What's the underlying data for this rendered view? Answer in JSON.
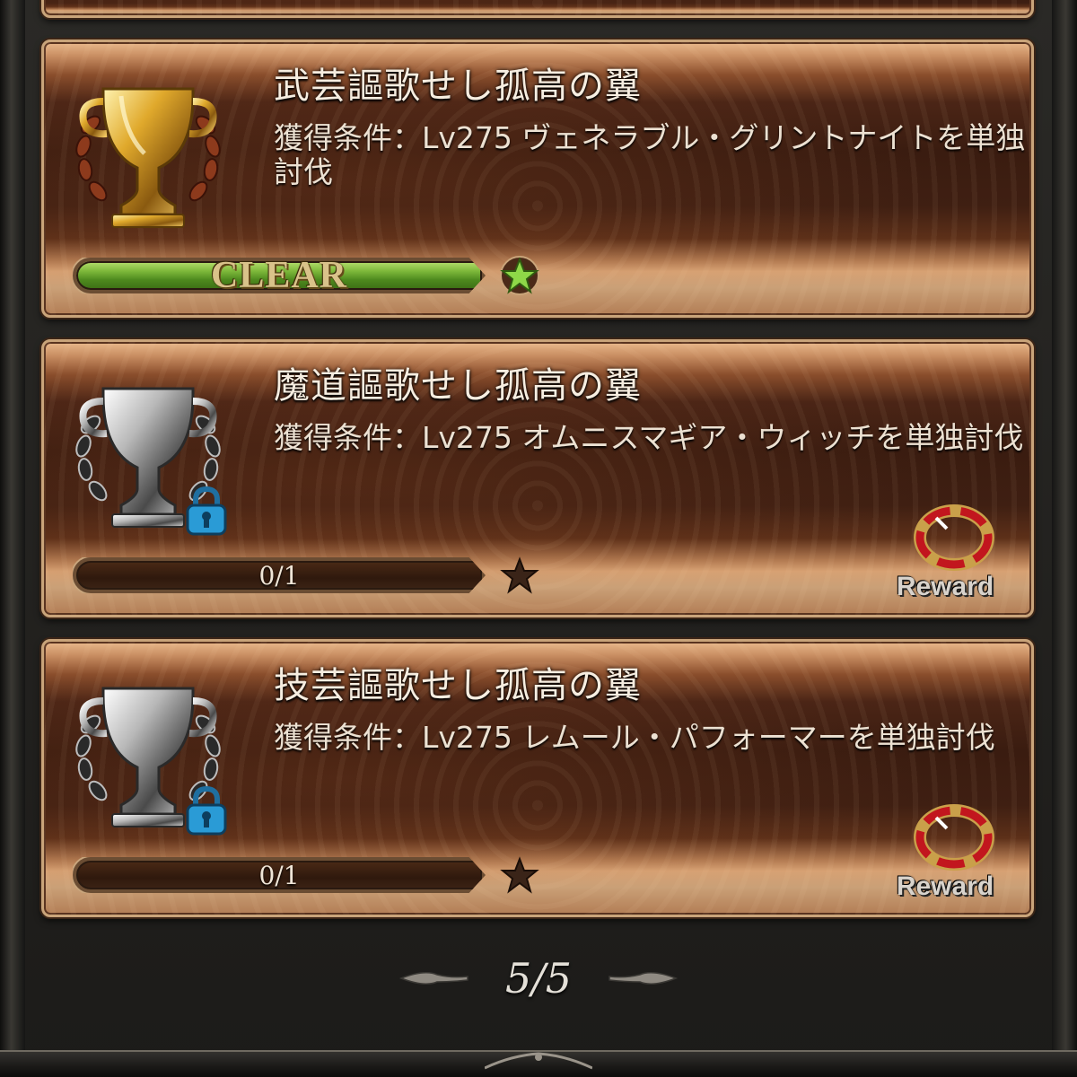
{
  "achievements": [
    {
      "title": "武芸謳歌せし孤高の翼",
      "condition": "獲得条件：Lv275 ヴェネラブル・グリントナイトを単独討伐",
      "status": "CLEAR",
      "trophy": "gold-trophy-icon",
      "star": "green-star-icon",
      "locked": false,
      "progress": 1.0
    },
    {
      "title": "魔道謳歌せし孤高の翼",
      "condition": "獲得条件：Lv275 オムニスマギア・ウィッチを単独討伐",
      "progress_text": "0/1",
      "trophy": "silver-trophy-icon",
      "star": "dark-star-icon",
      "locked": true,
      "reward_label": "Reward",
      "progress": 0.0
    },
    {
      "title": "技芸謳歌せし孤高の翼",
      "condition": "獲得条件：Lv275 レムール・パフォーマーを単独討伐",
      "progress_text": "0/1",
      "trophy": "silver-trophy-icon",
      "star": "dark-star-icon",
      "locked": true,
      "reward_label": "Reward",
      "progress": 0.0
    }
  ],
  "pager": {
    "text": "5/5",
    "current": 5,
    "total": 5
  },
  "colors": {
    "card_border": "#c9a47a",
    "clear_bar": "#7db83a",
    "lock_blue": "#2a9bd6",
    "reward_red": "#c2161e"
  }
}
